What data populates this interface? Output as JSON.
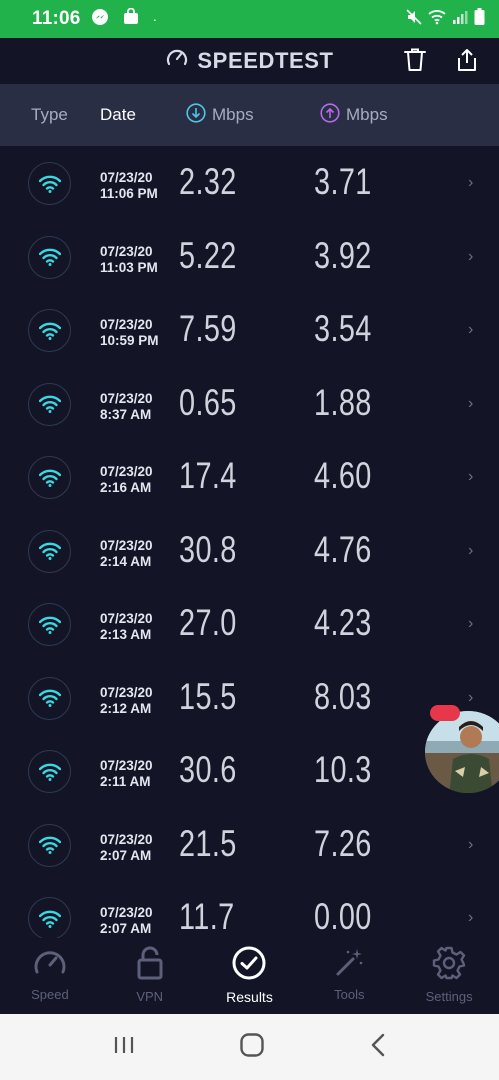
{
  "status_bar": {
    "time": "11:06",
    "dot": "·"
  },
  "app": {
    "title": "SPEEDTEST"
  },
  "columns": {
    "type": "Type",
    "date": "Date",
    "download": "Mbps",
    "upload": "Mbps"
  },
  "results": [
    {
      "date": "07/23/20",
      "time": "11:06 PM",
      "download": "2.32",
      "upload": "3.71"
    },
    {
      "date": "07/23/20",
      "time": "11:03 PM",
      "download": "5.22",
      "upload": "3.92"
    },
    {
      "date": "07/23/20",
      "time": "10:59 PM",
      "download": "7.59",
      "upload": "3.54"
    },
    {
      "date": "07/23/20",
      "time": "8:37 AM",
      "download": "0.65",
      "upload": "1.88"
    },
    {
      "date": "07/23/20",
      "time": "2:16 AM",
      "download": "17.4",
      "upload": "4.60"
    },
    {
      "date": "07/23/20",
      "time": "2:14 AM",
      "download": "30.8",
      "upload": "4.76"
    },
    {
      "date": "07/23/20",
      "time": "2:13 AM",
      "download": "27.0",
      "upload": "4.23"
    },
    {
      "date": "07/23/20",
      "time": "2:12 AM",
      "download": "15.5",
      "upload": "8.03"
    },
    {
      "date": "07/23/20",
      "time": "2:11 AM",
      "download": "30.6",
      "upload": "10.3"
    },
    {
      "date": "07/23/20",
      "time": "2:07 AM",
      "download": "21.5",
      "upload": "7.26"
    },
    {
      "date": "07/23/20",
      "time": "2:07 AM",
      "download": "11.7",
      "upload": "0.00"
    }
  ],
  "bottom_nav": [
    {
      "label": "Speed",
      "icon": "speedometer-icon"
    },
    {
      "label": "VPN",
      "icon": "lock-icon"
    },
    {
      "label": "Results",
      "icon": "check-circle-icon",
      "active": true
    },
    {
      "label": "Tools",
      "icon": "magic-wand-icon"
    },
    {
      "label": "Settings",
      "icon": "gear-icon"
    }
  ],
  "colors": {
    "status_bar": "#22b24c",
    "background": "#131527",
    "header_band": "#2a2e45",
    "wifi_accent": "#3ad8e0",
    "download_accent": "#4fc6e6",
    "upload_accent": "#b36be6"
  }
}
